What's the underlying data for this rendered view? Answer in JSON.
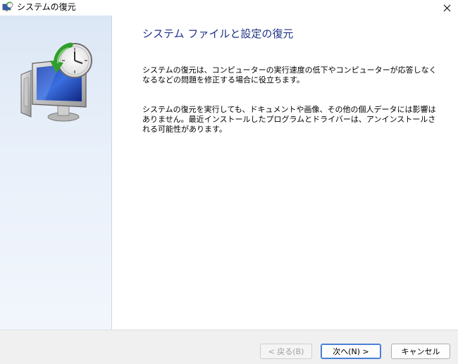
{
  "window": {
    "title": "システムの復元",
    "icon": "system-restore-icon"
  },
  "wizard": {
    "heading": "システム ファイルと設定の復元",
    "paragraph1": "システムの復元は、コンピューターの実行速度の低下やコンピューターが応答しなくなるなどの問題を修正する場合に役立ちます。",
    "paragraph2": "システムの復元を実行しても、ドキュメントや画像、その他の個人データには影響はありません。最近インストールしたプログラムとドライバーは、アンインストールされる可能性があります。"
  },
  "buttons": {
    "back": "< 戻る(B)",
    "next": "次へ(N) >",
    "cancel": "キャンセル"
  },
  "colors": {
    "heading": "#1e3287",
    "sidebar": "#dce7f5",
    "footer": "#f0f0f0",
    "accent": "#4a7fd6"
  }
}
